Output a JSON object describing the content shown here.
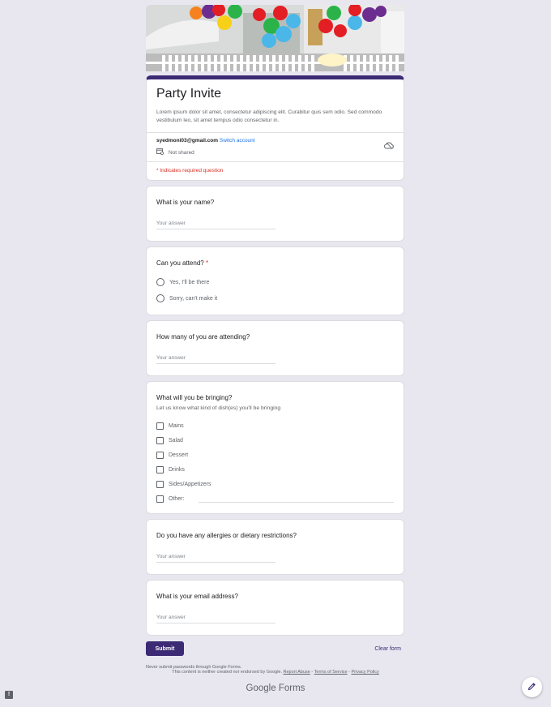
{
  "form": {
    "title": "Party Invite",
    "description": "Lorem ipsum dolor sit amet, consectetur adipiscing elit. Curabitur quis sem odio. Sed commodo vestibulum leo, sit amet tempus odio consectetur in.",
    "account_email": "syedmoni03@gmail.com",
    "switch_account": "Switch account",
    "not_shared": "Not shared",
    "required_note": "* Indicates required question",
    "accent_color": "#3c2a74"
  },
  "questions": {
    "name": {
      "label": "What is your name?",
      "placeholder": "Your answer"
    },
    "attend": {
      "label": "Can you attend?",
      "required_mark": "*",
      "options": [
        "Yes,  I'll be there",
        "Sorry, can't make it"
      ]
    },
    "count": {
      "label": "How many of you are attending?",
      "placeholder": "Your answer"
    },
    "bringing": {
      "label": "What will you be bringing?",
      "help": "Let us know what kind of dish(es) you'll be bringing",
      "options": [
        "Mains",
        "Salad",
        "Dessert",
        "Drinks",
        "Sides/Appetizers",
        "Other:"
      ]
    },
    "allergies": {
      "label": "Do you have any allergies or dietary restrictions?",
      "placeholder": "Your answer"
    },
    "email": {
      "label": "What is your email address?",
      "placeholder": "Your answer"
    }
  },
  "actions": {
    "submit": "Submit",
    "clear": "Clear form"
  },
  "footer": {
    "never_submit": "Never submit passwords through Google Forms.",
    "disclaimer_text": "This content is neither created nor endorsed by Google.",
    "report_abuse": "Report Abuse",
    "terms": "Terms of Service",
    "privacy": "Privacy Policy",
    "sep": " - ",
    "brand_google": "Google",
    "brand_forms": "Forms"
  },
  "icons": {
    "cloud": "cloud-off-icon",
    "not_shared": "not-shared-icon",
    "edit": "pencil-icon",
    "report": "report-icon"
  }
}
